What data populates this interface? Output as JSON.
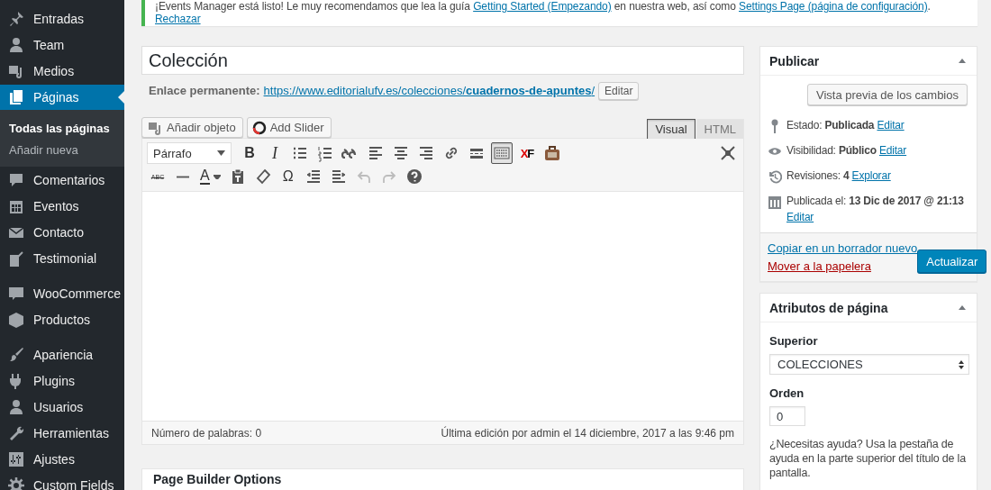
{
  "sidebar": {
    "groups": [
      [
        {
          "label": "Entradas",
          "selected": false
        },
        {
          "label": "Team",
          "selected": false
        },
        {
          "label": "Medios",
          "selected": false
        },
        {
          "label": "Páginas",
          "selected": true,
          "children": [
            {
              "label": "Todas las páginas",
              "selected": true
            },
            {
              "label": "Añadir nueva",
              "selected": false
            }
          ]
        },
        {
          "label": "Comentarios",
          "selected": false
        },
        {
          "label": "Eventos",
          "selected": false
        },
        {
          "label": "Contacto",
          "selected": false
        },
        {
          "label": "Testimonial",
          "selected": false
        }
      ],
      [
        {
          "label": "WooCommerce",
          "selected": false
        },
        {
          "label": "Productos",
          "selected": false
        }
      ],
      [
        {
          "label": "Apariencia",
          "selected": false
        },
        {
          "label": "Plugins",
          "selected": false
        },
        {
          "label": "Usuarios",
          "selected": false
        },
        {
          "label": "Herramientas",
          "selected": false
        },
        {
          "label": "Ajustes",
          "selected": false
        },
        {
          "label": "Custom Fields",
          "selected": false
        }
      ]
    ]
  },
  "notice": {
    "segments": [
      {
        "kind": "text",
        "text": "¡Events Manager está listo! Le muy recomendamos que lea la guía "
      },
      {
        "kind": "link",
        "text": "Getting Started (Empezando)"
      },
      {
        "kind": "text",
        "text": " en nuestra web, así como "
      },
      {
        "kind": "link",
        "text": "Settings Page (página de configuración)"
      },
      {
        "kind": "text",
        "text": "."
      }
    ],
    "dismiss": "Rechazar"
  },
  "editor": {
    "title": "Colección",
    "permalink": {
      "label": "Enlace permanente:",
      "url": "https://www.editorialufv.es/colecciones/**cuadernos-de-apuntes**/",
      "button": "Editar"
    },
    "media_buttons": [
      "Añadir objeto",
      "Add Slider"
    ],
    "tabs": [
      {
        "label": "Visual",
        "selected": true
      },
      {
        "label": "HTML",
        "selected": false
      }
    ],
    "toolbar": [
      [
        {
          "kind": "select",
          "label": "Párrafo",
          "on": false,
          "disabled": false
        },
        {
          "kind": "bold",
          "label": "B",
          "on": false,
          "disabled": false
        },
        {
          "kind": "italic",
          "label": "I",
          "on": false,
          "disabled": false
        },
        {
          "kind": "icon",
          "on": false,
          "disabled": false
        },
        {
          "kind": "icon",
          "on": false,
          "disabled": false
        },
        {
          "kind": "icon",
          "on": false,
          "disabled": false
        },
        {
          "kind": "icon",
          "on": false,
          "disabled": false
        },
        {
          "kind": "icon",
          "on": false,
          "disabled": false
        },
        {
          "kind": "icon",
          "on": false,
          "disabled": false
        },
        {
          "kind": "icon",
          "on": false,
          "disabled": false
        },
        {
          "kind": "icon",
          "on": false,
          "disabled": false
        },
        {
          "kind": "icon",
          "on": true,
          "disabled": false
        },
        {
          "kind": "logo",
          "label": "XF",
          "on": false,
          "disabled": false
        },
        {
          "kind": "icon",
          "on": false,
          "disabled": false
        }
      ],
      [
        {
          "kind": "strike",
          "label": "ABC",
          "on": false,
          "disabled": false
        },
        {
          "kind": "icon",
          "on": false,
          "disabled": false
        },
        {
          "kind": "color",
          "label": "A",
          "on": false,
          "disabled": false
        },
        {
          "kind": "icon",
          "on": false,
          "disabled": false
        },
        {
          "kind": "icon",
          "on": false,
          "disabled": false
        },
        {
          "kind": "glyph",
          "label": "Ω",
          "on": false,
          "disabled": false
        },
        {
          "kind": "icon",
          "on": false,
          "disabled": false
        },
        {
          "kind": "icon",
          "on": false,
          "disabled": false
        },
        {
          "kind": "icon",
          "on": false,
          "disabled": true
        },
        {
          "kind": "icon",
          "on": false,
          "disabled": true
        },
        {
          "kind": "icon",
          "on": false,
          "disabled": false
        }
      ]
    ],
    "footer": {
      "word_count": "Número de palabras: 0",
      "last_edit": "Última edición por admin el 14 diciembre, 2017 a las 9:46 pm"
    }
  },
  "page_builder": {
    "title": "Page Builder Options"
  },
  "publish": {
    "title": "Publicar",
    "preview": "Vista previa de los cambios",
    "rows": [
      {
        "label": "Estado:",
        "value": "Publicada",
        "link": "Editar"
      },
      {
        "label": "Visibilidad:",
        "value": "Público",
        "link": "Editar"
      },
      {
        "label": "Revisiones:",
        "value": "4",
        "link": "Explorar"
      },
      {
        "label": "Publicada el:",
        "value": "13 Dic de 2017 @ 21:13",
        "link": "Editar"
      }
    ],
    "copy_link": "Copiar en un borrador nuevo",
    "trash_link": "Mover a la papelera",
    "update": "Actualizar"
  },
  "attributes": {
    "title": "Atributos de página",
    "parent_label": "Superior",
    "parent_value": "COLECCIONES",
    "order_label": "Orden",
    "order_value": "0",
    "help": "¿Necesitas ayuda? Usa la pestaña de ayuda en la parte superior del título de la pantalla."
  }
}
